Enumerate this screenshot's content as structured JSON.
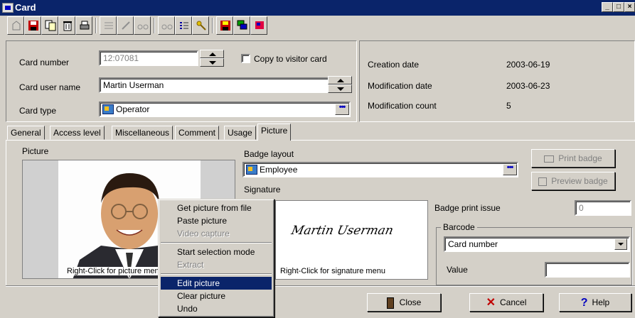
{
  "window": {
    "title": "Card",
    "buttons": {
      "minimize": "_",
      "restore": "□",
      "close": "×"
    }
  },
  "toolbar": {
    "icons": [
      "up-folder-icon",
      "save-icon",
      "copy-icon",
      "delete-icon",
      "print-icon",
      "list-icon",
      "edit-icon",
      "find-icon",
      "find-next-icon",
      "details-icon",
      "key-icon",
      "save-all-icon",
      "stack-icon",
      "flag-icon"
    ]
  },
  "card": {
    "card_number_label": "Card number",
    "card_number_value": "12:07081",
    "copy_to_visitor_label": "Copy to visitor card",
    "card_user_name_label": "Card user name",
    "card_user_name_value": "Martin Userman",
    "card_type_label": "Card type",
    "card_type_value": "Operator",
    "dots": "•••"
  },
  "info": {
    "creation_date_label": "Creation date",
    "creation_date_value": "2003-06-19",
    "modification_date_label": "Modification date",
    "modification_date_value": "2003-06-23",
    "modification_count_label": "Modification count",
    "modification_count_value": "5"
  },
  "tabs": [
    "General",
    "Access level",
    "Miscellaneous",
    "Comment",
    "Usage",
    "Picture"
  ],
  "active_tab": "Picture",
  "picture": {
    "label": "Picture",
    "caption": "Right-Click for picture menu",
    "badge_layout_label": "Badge layout",
    "badge_layout_value": "Employee",
    "signature_label": "Signature",
    "signature_script": "Martin Userman",
    "signature_caption": "Right-Click for signature menu",
    "print_badge": "Print badge",
    "preview_badge": "Preview badge",
    "badge_print_issue_label": "Badge print issue",
    "badge_print_issue_value": "0",
    "barcode_label": "Barcode",
    "barcode_value": "Card number",
    "value_label": "Value",
    "value_value": ""
  },
  "context_menu": {
    "items": [
      {
        "label": "Get picture from file",
        "state": "enabled"
      },
      {
        "label": "Paste picture",
        "state": "enabled"
      },
      {
        "label": "Video capture",
        "state": "disabled"
      },
      {
        "label": "Start selection mode",
        "state": "enabled"
      },
      {
        "label": "Extract",
        "state": "disabled"
      },
      {
        "label": "Edit picture",
        "state": "selected"
      },
      {
        "label": "Clear picture",
        "state": "enabled"
      },
      {
        "label": "Undo",
        "state": "enabled"
      }
    ]
  },
  "footer": {
    "close": "Close",
    "cancel": "Cancel",
    "help": "Help"
  },
  "colors": {
    "titlebar": "#0a246a",
    "face": "#d4d0c8",
    "selection": "#0a246a"
  }
}
